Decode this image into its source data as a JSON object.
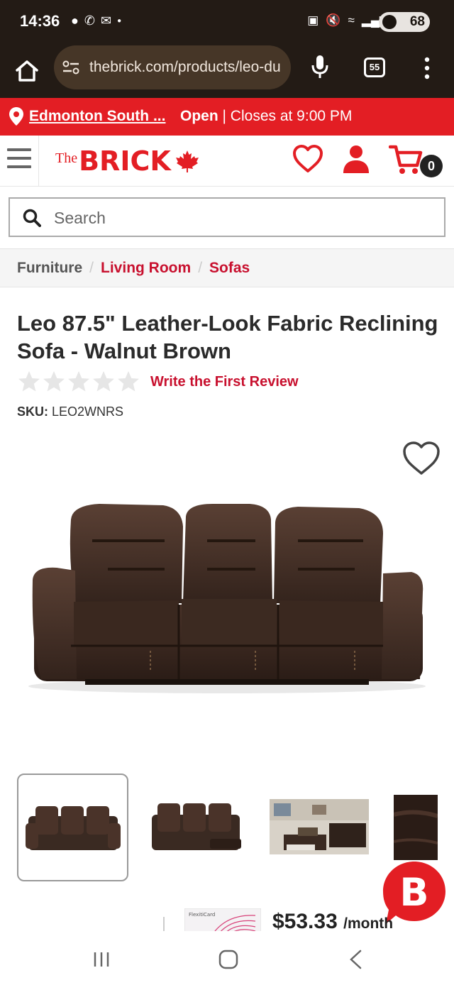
{
  "status_bar": {
    "time": "14:36",
    "battery": "68"
  },
  "browser": {
    "url": "thebrick.com/products/leo-du",
    "tab_count": "55"
  },
  "store": {
    "name": "Edmonton South ...",
    "status_open": "Open",
    "status_hours": "| Closes at 9:00 PM"
  },
  "header": {
    "logo_the": "The",
    "logo_brick": "BRICK",
    "cart_count": "0"
  },
  "search": {
    "placeholder": "Search"
  },
  "breadcrumb": {
    "items": [
      "Furniture",
      "Living Room",
      "Sofas"
    ]
  },
  "product": {
    "title": "Leo 87.5\" Leather-Look Fabric Reclining Sofa - Walnut Brown",
    "review_link": "Write the First Review",
    "rating": 0,
    "rating_max": 5,
    "sku_label": "SKU:",
    "sku": "LEO2WNRS"
  },
  "financing": {
    "card_label": "FlexitiCard",
    "price": "$53.33",
    "period": "/month"
  },
  "colors": {
    "brand_red": "#e31e24",
    "link_red": "#c8102e",
    "leather_brown": "#3a2a22"
  }
}
